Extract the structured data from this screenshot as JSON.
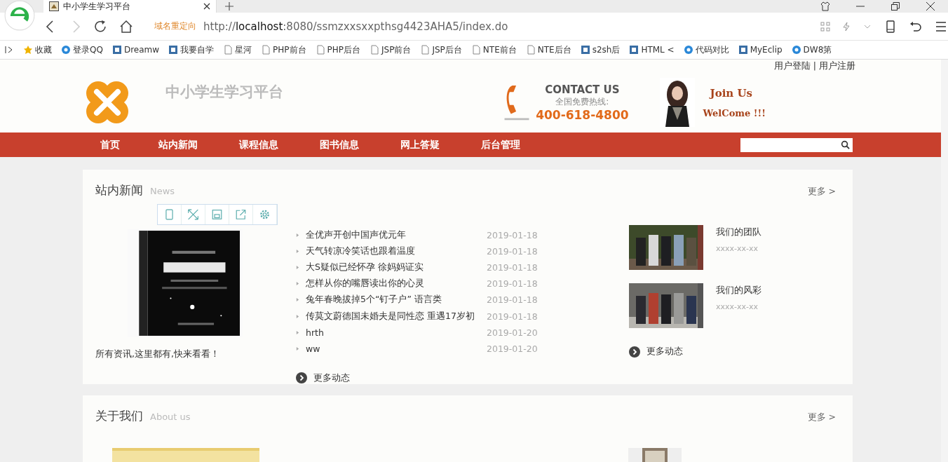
{
  "browser": {
    "tab_title": "中小学生学习平台",
    "url_hint": "域名重定向",
    "url_host": "localhost",
    "url_scheme": "http://",
    "url_rest": ":8080/ssmzxxsxxpthsg4423AHA5/index.do",
    "bookmarks": [
      {
        "label": "收藏",
        "kind": "star"
      },
      {
        "label": "登录QQ",
        "kind": "round"
      },
      {
        "label": "Dreamw",
        "kind": "square"
      },
      {
        "label": "我要自学",
        "kind": "square"
      },
      {
        "label": "星河",
        "kind": "page"
      },
      {
        "label": "PHP前台",
        "kind": "page"
      },
      {
        "label": "PHP后台",
        "kind": "page"
      },
      {
        "label": "JSP前台",
        "kind": "page"
      },
      {
        "label": "JSP后台",
        "kind": "page"
      },
      {
        "label": "NTE前台",
        "kind": "page"
      },
      {
        "label": "NTE后台",
        "kind": "page"
      },
      {
        "label": "s2sh后",
        "kind": "square"
      },
      {
        "label": "HTML <",
        "kind": "square"
      },
      {
        "label": "代码对比",
        "kind": "round"
      },
      {
        "label": "MyEclip",
        "kind": "square"
      },
      {
        "label": "DW8第",
        "kind": "round"
      }
    ]
  },
  "header": {
    "user_links": [
      "用户登陆",
      "用户注册"
    ],
    "link_separator": "|",
    "site_title": "中小学生学习平台",
    "contact_heading": "CONTACT US",
    "hotline_label": "全国免费热线:",
    "phone": "400-618-4800",
    "join_title": "Join Us",
    "welcome": "WelCome !!!"
  },
  "nav": {
    "items": [
      "首页",
      "站内新闻",
      "课程信息",
      "图书信息",
      "网上答疑",
      "后台管理"
    ]
  },
  "news": {
    "title": "站内新闻",
    "subtitle": "News",
    "more": "更多 >",
    "caption": "所有资讯,这里都有,快来看看！",
    "items": [
      {
        "title": "全优声开创中国声优元年",
        "date": "2019-01-18"
      },
      {
        "title": "天气转凉冷笑话也跟着温度",
        "date": "2019-01-18"
      },
      {
        "title": "大S疑似已经怀孕 徐妈妈证实",
        "date": "2019-01-18"
      },
      {
        "title": "怎样从你的嘴唇读出你的心灵",
        "date": "2019-01-18"
      },
      {
        "title": "兔年春晚拔掉5个“钉子户” 语言类",
        "date": "2019-01-18"
      },
      {
        "title": "传莫文蔚德国未婚夫是同性恋 重遇17岁初",
        "date": "2019-01-18"
      },
      {
        "title": "hrth",
        "date": "2019-01-20"
      },
      {
        "title": "ww",
        "date": "2019-01-20"
      }
    ],
    "more_link": "更多动态",
    "gallery": [
      {
        "title": "我们的团队",
        "date": "xxxx-xx-xx"
      },
      {
        "title": "我们的风彩",
        "date": "xxxx-xx-xx"
      }
    ],
    "gallery_more": "更多动态"
  },
  "about": {
    "title": "关于我们",
    "subtitle": "About us",
    "more": "更多 >"
  }
}
